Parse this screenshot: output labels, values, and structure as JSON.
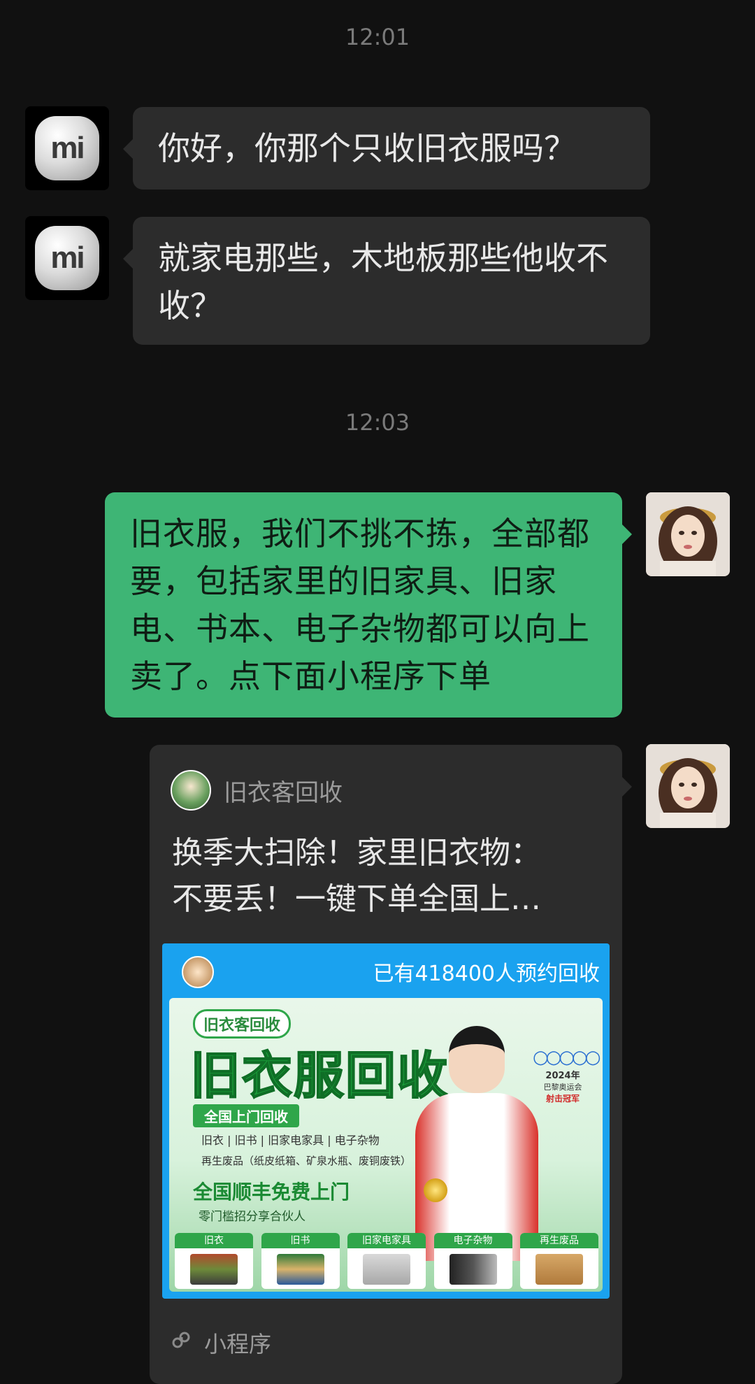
{
  "timestamps": [
    "12:01",
    "12:03"
  ],
  "messages": [
    {
      "from": "contact",
      "avatar": "mi-logo-icon",
      "text": "你好，你那个只收旧衣服吗？"
    },
    {
      "from": "contact",
      "avatar": "mi-logo-icon",
      "text": "就家电那些，木地板那些他收不收？"
    },
    {
      "from": "me",
      "avatar": "girl-portrait-avatar",
      "text": "旧衣服，我们不挑不拣，全部都要，包括家里的旧家具、旧家电、书本、电子杂物都可以向上卖了。点下面小程序下单"
    }
  ],
  "mini_program": {
    "app_name": "旧衣客回收",
    "title_line1": "换季大扫除！家里旧衣物：",
    "title_line2": "不要丢！一键下单全国上…",
    "footer_label": "小程序",
    "footer_icon": "mini-program-icon",
    "image": {
      "count_text": "已有418400人预约回收",
      "brand_tag": "旧衣客回收",
      "big_title": "旧衣服回收",
      "sub_tag": "全国上门回收",
      "line1": "旧衣 | 旧书 | 旧家电家具 | 电子杂物",
      "line2": "再生废品（纸皮纸箱、矿泉水瓶、废铜废铁）",
      "line3": "全国顺丰免费上门",
      "line4": "零门槛招分享合伙人",
      "olympic_year": "2024年",
      "olympic_name": "巴黎奥运会",
      "olympic_champ": "射击冠军",
      "categories": [
        "旧衣",
        "旧书",
        "旧家电家具",
        "电子杂物",
        "再生废品"
      ]
    }
  },
  "colors": {
    "background": "#111111",
    "incoming_bubble": "#2c2c2c",
    "outgoing_bubble": "#3eb575",
    "image_banner": "#1aa2ef"
  }
}
